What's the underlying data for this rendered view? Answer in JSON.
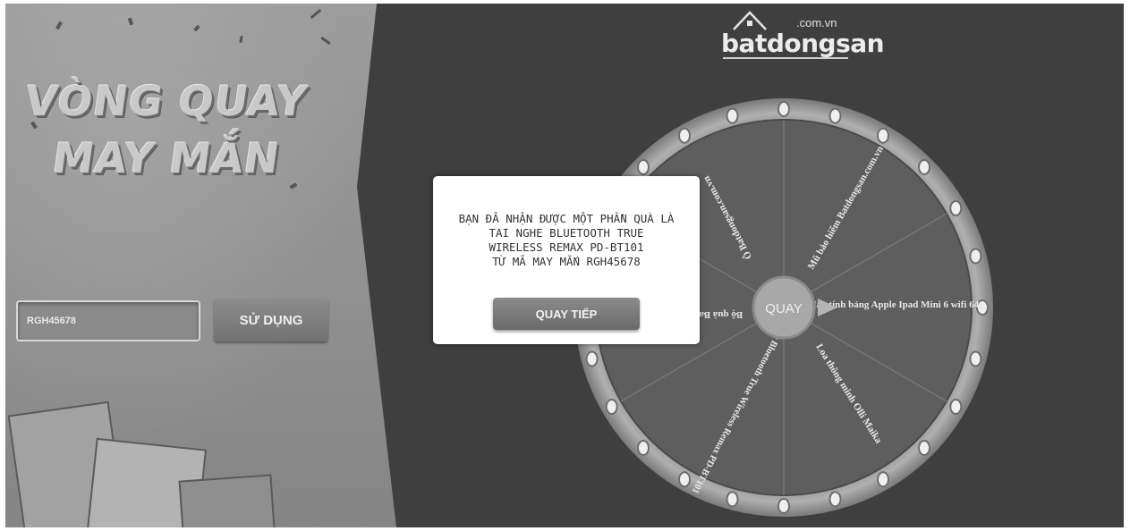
{
  "banner": {
    "title_line1": "VÒNG QUAY",
    "title_line2": "MAY MẮN",
    "code_input_value": "RGH45678",
    "use_button_label": "SỬ DỤNG"
  },
  "logo": {
    "name": "batdongsan",
    "domain": ".com.vn"
  },
  "wheel": {
    "center_label": "QUAY",
    "segments": [
      {
        "label": "Mũ bảo hiểm Batdongsan.com.vn"
      },
      {
        "label": "Máy tính bảng Apple Ipad Mini 6 wifi 64g"
      },
      {
        "label": "Loa thông minh Olli Maika"
      },
      {
        "label": "Tai nghe Bluetooth True Wireless Remax PD-BT101"
      },
      {
        "label": "Bộ quà Baseus"
      },
      {
        "label": "Ô Batdongsan.com.vn"
      }
    ]
  },
  "modal": {
    "message_lines": [
      "BẠN ĐÃ NHẬN ĐƯỢC MỘT PHẦN QUÀ LÀ",
      "TAI NGHE BLUETOOTH TRUE",
      "WIRELESS REMAX PD-BT101",
      "TỪ MÃ MAY MẮN RGH45678"
    ],
    "button_label": "QUAY TIẾP"
  },
  "colors": {
    "background": "#3f3f3f",
    "banner": "#909090",
    "wheel_face": "#5e5e5e",
    "wheel_rim": "#a3a3a3",
    "modal": "#ffffff"
  }
}
